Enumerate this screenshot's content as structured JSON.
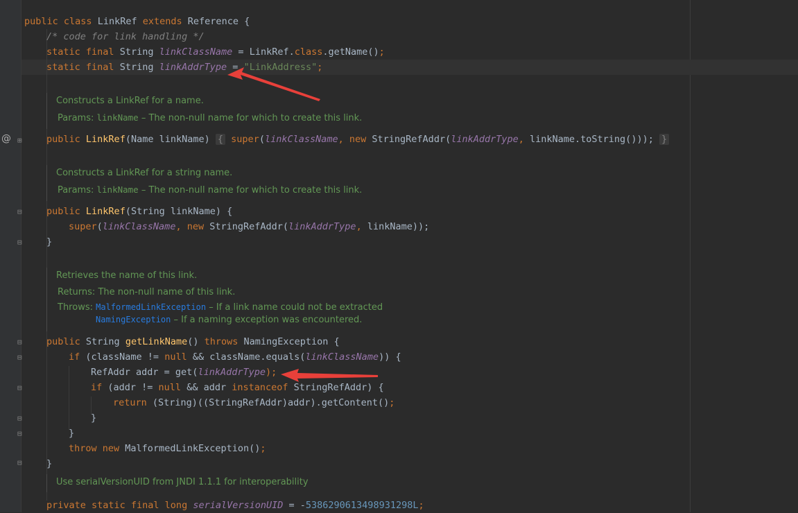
{
  "code": {
    "class_decl": {
      "kw1": "public",
      "kw2": "class",
      "name": "LinkRef",
      "kw3": "extends",
      "parent": "Reference",
      "brace": "{"
    },
    "comment": "/* code for link handling */",
    "field1": {
      "mods": "static final",
      "type": "String",
      "name": "linkClassName",
      "eq": "=",
      "value": "LinkRef.",
      "kw": "class",
      "tail": ".getName()",
      "semi": ";"
    },
    "field2": {
      "mods": "static final",
      "type": "String",
      "name": "linkAddrType",
      "eq": "=",
      "value": "\"LinkAddress\"",
      "semi": ";"
    },
    "doc1": {
      "summary": "Constructs a LinkRef for a name.",
      "params_label": "Params:",
      "param_name": "linkName",
      "param_desc": " – The non-null name for which to create this link."
    },
    "ctor1": {
      "kw": "public",
      "name": "LinkRef",
      "args": "(Name linkName)",
      "open": "{",
      "super": "super",
      "p1": "(",
      "a1": "linkClassName",
      "c1": ", ",
      "new": "new",
      "cls": " StringRefAddr(",
      "a2": "linkAddrType",
      "c2": ", ",
      "rest": "linkName.toString()));",
      "close": "}"
    },
    "doc2": {
      "summary": "Constructs a LinkRef for a string name.",
      "params_label": "Params:",
      "param_name": "linkName",
      "param_desc": " – The non-null name for which to create this link."
    },
    "ctor2": {
      "kw": "public",
      "name": "LinkRef",
      "args": "(String linkName) {",
      "super": "super",
      "p1": "(",
      "a1": "linkClassName",
      "c1": ", ",
      "new": "new",
      "cls": " StringRefAddr(",
      "a2": "linkAddrType",
      "c2": ", ",
      "rest": "linkName));",
      "close": "}"
    },
    "doc3": {
      "summary": "Retrieves the name of this link.",
      "returns_label": "Returns:",
      "returns_desc": "The non-null name of this link.",
      "throws_label": "Throws:",
      "ex1": "MalformedLinkException",
      "ex1_desc": " – If a link name could not be extracted",
      "ex2": "NamingException",
      "ex2_desc": " – If a naming exception was encountered."
    },
    "method": {
      "sig_kw": "public",
      "sig_type": " String ",
      "sig_name": "getLinkName",
      "sig_paren": "() ",
      "sig_throws": "throws",
      "sig_ex": " NamingException {",
      "if1_kw": "if",
      "if1_a": " (className != ",
      "if1_null": "null",
      "if1_b": " && className.equals(",
      "if1_fld": "linkClassName",
      "if1_c": ")) {",
      "l3_a": "RefAddr addr = get(",
      "l3_fld": "linkAddrType",
      "l3_b": ");",
      "if2_kw": "if",
      "if2_a": " (addr != ",
      "if2_null": "null",
      "if2_b": " && addr ",
      "if2_inst": "instanceof",
      "if2_c": " StringRefAddr) {",
      "ret_kw": "return",
      "ret_rest": " (String)((StringRefAddr)addr).getContent()",
      "ret_semi": ";",
      "close1": "}",
      "close2": "}",
      "throw_kw": "throw",
      "throw_new": "new",
      "throw_rest": " MalformedLinkException()",
      "throw_semi": ";",
      "close3": "}"
    },
    "doc4": {
      "summary": "Use serialVersionUID from JNDI 1.1.1 for interoperability"
    },
    "serial": {
      "mods": "private static final long",
      "name": "serialVersionUID",
      "eq": " = -",
      "value": "5386290613498931298L",
      "semi": ";"
    }
  },
  "gutter": {
    "override_marker": "@"
  },
  "annotations": {
    "arrow_color": "#e8403a"
  },
  "colors": {
    "background": "#2b2b2b",
    "keyword": "#cc7832",
    "field": "#9876aa",
    "string": "#6a8759",
    "number": "#6897bb",
    "method": "#ffc66d",
    "doc": "#629755"
  }
}
